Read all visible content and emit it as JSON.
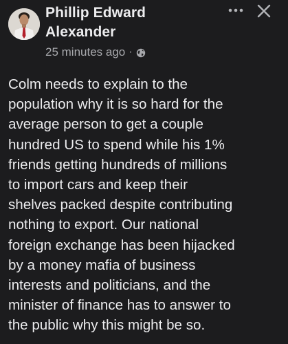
{
  "post": {
    "author": {
      "name_line1": "Phillip Edward",
      "name_line2": "Alexander"
    },
    "timestamp": "25 minutes ago",
    "separator": "·",
    "audience_icon": "globe-icon",
    "actions": {
      "more_icon": "more-horizontal-icon",
      "close_icon": "close-icon"
    },
    "body_lines": [
      "Colm needs to explain to the",
      "population why it is so hard for the",
      "average person to get a couple",
      "hundred US to spend while his 1%",
      "friends getting hundreds of millions",
      "to import cars and keep their",
      "shelves packed despite contributing",
      "nothing to export. Our national",
      "foreign exchange has been hijacked",
      "by a money mafia of business",
      "interests and politicians, and the",
      "minister of finance has to answer to",
      "the public why this might be so."
    ]
  },
  "colors": {
    "background": "#1c1c1e",
    "text_primary": "#ececee",
    "text_secondary": "#a8a9ad"
  }
}
